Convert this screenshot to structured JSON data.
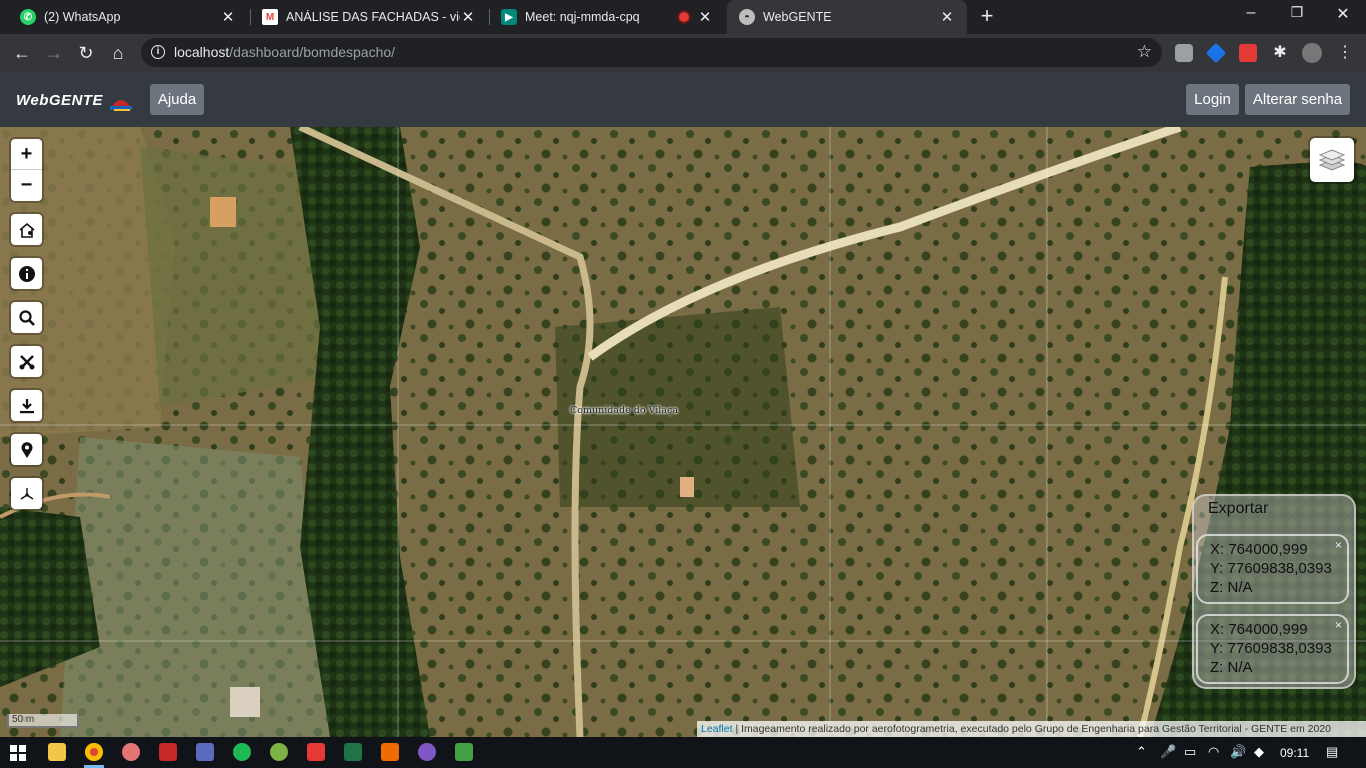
{
  "browser": {
    "tabs": [
      {
        "title": "(2) WhatsApp",
        "favicon": "whatsapp-icon",
        "color": "#25d366",
        "active": false
      },
      {
        "title": "ANÁLISE DAS FACHADAS - victor",
        "favicon": "gmail-icon",
        "color": "#ea4335",
        "active": false
      },
      {
        "title": "Meet: nqj-mmda-cpq",
        "favicon": "meet-icon",
        "color": "#00897b",
        "active": false,
        "recording": true
      },
      {
        "title": "WebGENTE",
        "favicon": "webgente-icon",
        "color": "#9e9e9e",
        "active": true
      }
    ],
    "url_host": "localhost",
    "url_path": "/dashboard/bomdespacho/",
    "window_controls": {
      "minimize": "–",
      "restore": "❐",
      "close": "✕"
    }
  },
  "navbar": {
    "logo_text": "WebGENTE",
    "help_label": "Ajuda",
    "login_label": "Login",
    "change_password_label": "Alterar senha"
  },
  "map": {
    "zoom_in": "+",
    "zoom_out": "−",
    "tools": [
      "home-icon",
      "info-icon",
      "search-icon",
      "measure-icon",
      "download-icon",
      "marker-icon",
      "coordinates-icon"
    ],
    "place_label": "Comunidade do Vilaça",
    "scale_label": "50 m",
    "attribution_link": "Leaflet",
    "attribution_text": " | Imageamento realizado por aerofotogrametria, executado pelo Grupo de Engenharia para Gestão Territorial - GENTE em 2020"
  },
  "export_panel": {
    "title": "Exportar",
    "entries": [
      {
        "x": "X: 764000,999",
        "y": "Y: 77609838,0393",
        "z": "Z: N/A"
      },
      {
        "x": "X: 764000,999",
        "y": "Y: 77609838,0393",
        "z": "Z: N/A"
      }
    ]
  },
  "taskbar": {
    "clock": "09:11",
    "apps": [
      "explorer-icon",
      "chrome-icon",
      "app-icon",
      "acrobat-icon",
      "network-icon",
      "spotify-icon",
      "qgis-icon",
      "webgente-icon",
      "excel-icon",
      "app-icon",
      "app-icon",
      "app-icon"
    ]
  },
  "colors": {
    "navbar": "#343a40",
    "button": "#6c757d",
    "tabbar": "#202124"
  }
}
